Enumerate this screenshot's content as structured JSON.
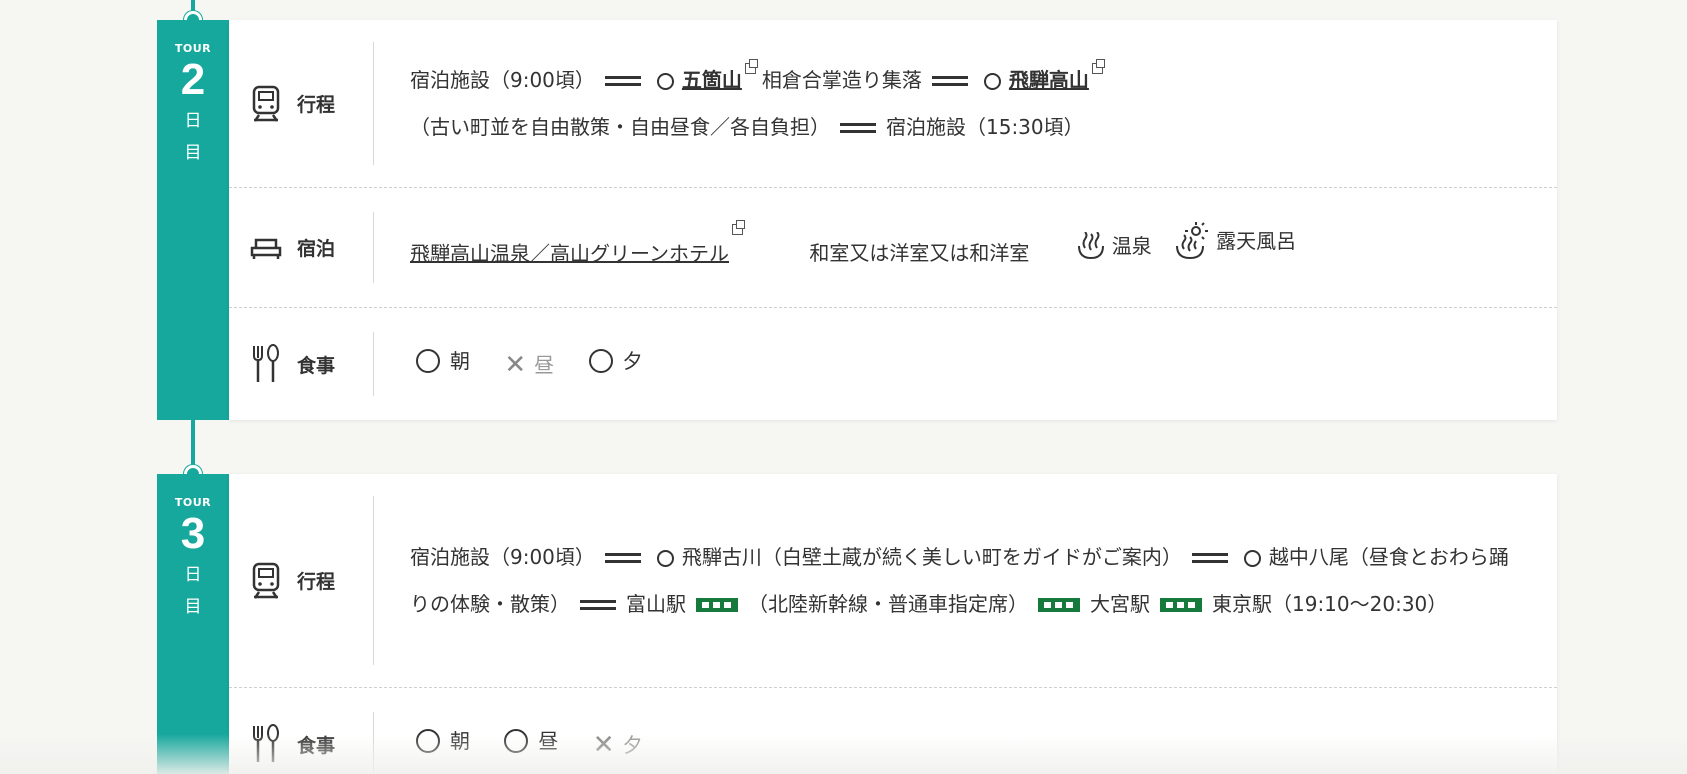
{
  "days": [
    {
      "tour_label": "TOUR",
      "day_number": "2",
      "day_kanji_1": "日",
      "day_kanji_2": "目",
      "itinerary_label": "行程",
      "itinerary": {
        "seg1": "宿泊施設（9:00頃）",
        "seg2_link": "五箇山",
        "seg2_after": "相倉合掌造り集落",
        "seg3_link": "飛騨高山",
        "seg3_after": "（古い町並を自由散策・自由昼食／各自負担）",
        "seg4": "宿泊施設（15:30頃）"
      },
      "lodging_label": "宿泊",
      "lodging": {
        "hotel_link": "飛騨高山温泉／高山グリーンホテル",
        "room_type": "和室又は洋室又は和洋室",
        "onsen": "温泉",
        "rotenburo": "露天風呂"
      },
      "meals_label": "食事",
      "meals": [
        {
          "name": "朝",
          "included": true
        },
        {
          "name": "昼",
          "included": false
        },
        {
          "name": "夕",
          "included": true
        }
      ]
    },
    {
      "tour_label": "TOUR",
      "day_number": "3",
      "day_kanji_1": "日",
      "day_kanji_2": "目",
      "itinerary_label": "行程",
      "itinerary": {
        "seg1": "宿泊施設（9:00頃）",
        "seg2": "飛騨古川（白壁土蔵が続く美しい町をガイドがご案内）",
        "seg3": "越中八尾（昼食とおわら踊りの体験・散策）",
        "seg4": "富山駅",
        "seg5": "（北陸新幹線・普通車指定席）",
        "seg6": "大宮駅",
        "seg7": "東京駅（19:10〜20:30）"
      },
      "meals_label": "食事",
      "meals": [
        {
          "name": "朝",
          "included": true
        },
        {
          "name": "昼",
          "included": true
        },
        {
          "name": "夕",
          "included": false
        }
      ]
    }
  ],
  "colors": {
    "accent": "#16a89d",
    "train": "#157a3c"
  }
}
